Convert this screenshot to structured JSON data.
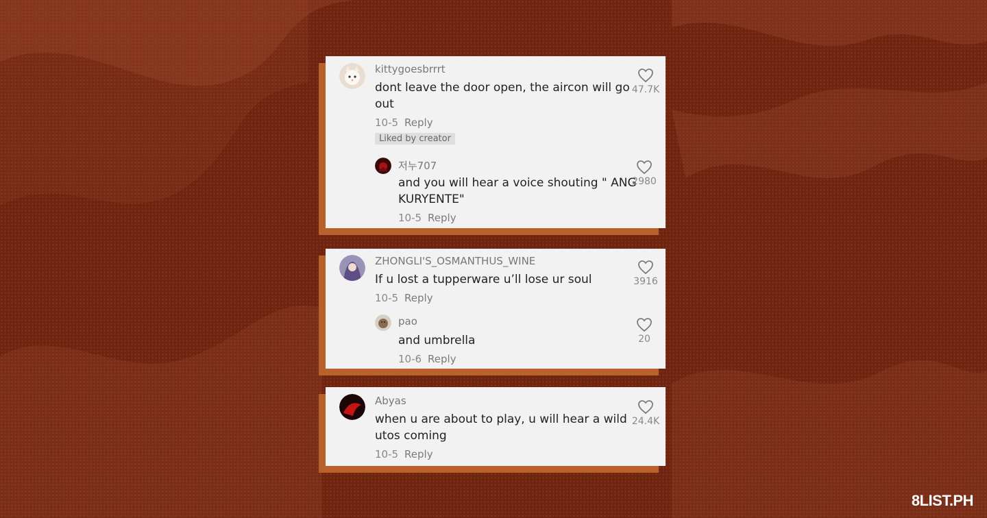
{
  "threads": [
    {
      "comment": {
        "username": "kittygoesbrrrt",
        "lines": [
          "dont leave the door open, the aircon will go",
          "out"
        ],
        "date": "10-5",
        "reply": "Reply",
        "likes": "47.7K",
        "badge": "Liked by creator"
      },
      "reply": {
        "username": "저누707",
        "lines": [
          "and you will hear a voice shouting \" ANG",
          "KURYENTE\""
        ],
        "date": "10-5",
        "reply": "Reply",
        "likes": "2980"
      }
    },
    {
      "comment": {
        "username": "ZHONGLI'S_OSMANTHUS_WINE",
        "lines": [
          "If u lost a tupperware u’ll lose ur soul"
        ],
        "date": "10-5",
        "reply": "Reply",
        "likes": "3916"
      },
      "reply": {
        "username": "pao",
        "lines": [
          "and umbrella"
        ],
        "date": "10-6",
        "reply": "Reply",
        "likes": "20"
      }
    },
    {
      "comment": {
        "username": "Abyas",
        "lines": [
          "when u are about to play, u will hear a wild",
          "utos coming"
        ],
        "date": "10-5",
        "reply": "Reply",
        "likes": "24.4K"
      }
    }
  ],
  "watermark": "8LIST.PH",
  "colors": {
    "background": "#6f2410",
    "card": "#f2f2f2",
    "card_shadow": "#b9612a"
  }
}
